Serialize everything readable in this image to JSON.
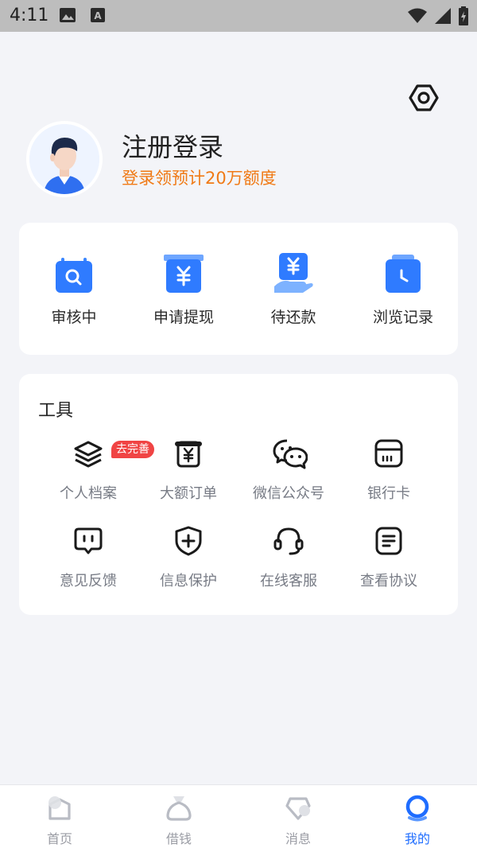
{
  "status_bar": {
    "time": "4:11",
    "icons": [
      "image-icon",
      "font-icon",
      "wifi-icon",
      "signal-icon",
      "battery-charging-icon"
    ]
  },
  "header": {
    "settings_icon": "settings-hex-icon"
  },
  "profile": {
    "name": "注册登录",
    "subtitle": "登录领预计20万额度"
  },
  "status_items": [
    {
      "label": "审核中",
      "icon": "review-search-icon"
    },
    {
      "label": "申请提现",
      "icon": "withdraw-yen-icon"
    },
    {
      "label": "待还款",
      "icon": "repay-hand-yen-icon"
    },
    {
      "label": "浏览记录",
      "icon": "history-clock-icon"
    }
  ],
  "tools": {
    "title": "工具",
    "items": [
      {
        "label": "个人档案",
        "icon": "layers-icon",
        "badge": "去完善"
      },
      {
        "label": "大额订单",
        "icon": "yen-order-icon"
      },
      {
        "label": "微信公众号",
        "icon": "wechat-icon"
      },
      {
        "label": "银行卡",
        "icon": "bank-card-icon"
      },
      {
        "label": "意见反馈",
        "icon": "feedback-chat-icon"
      },
      {
        "label": "信息保护",
        "icon": "shield-plus-icon"
      },
      {
        "label": "在线客服",
        "icon": "headset-icon"
      },
      {
        "label": "查看协议",
        "icon": "document-icon"
      }
    ]
  },
  "bottom_nav": {
    "items": [
      {
        "label": "首页",
        "icon": "home-icon",
        "active": false
      },
      {
        "label": "借钱",
        "icon": "borrow-icon",
        "active": false
      },
      {
        "label": "消息",
        "icon": "message-icon",
        "active": false
      },
      {
        "label": "我的",
        "icon": "profile-ring-icon",
        "active": true
      }
    ]
  },
  "colors": {
    "accent": "#1f6dff",
    "orange": "#f07a16",
    "badge": "#f04444",
    "background": "#f3f4f8"
  }
}
